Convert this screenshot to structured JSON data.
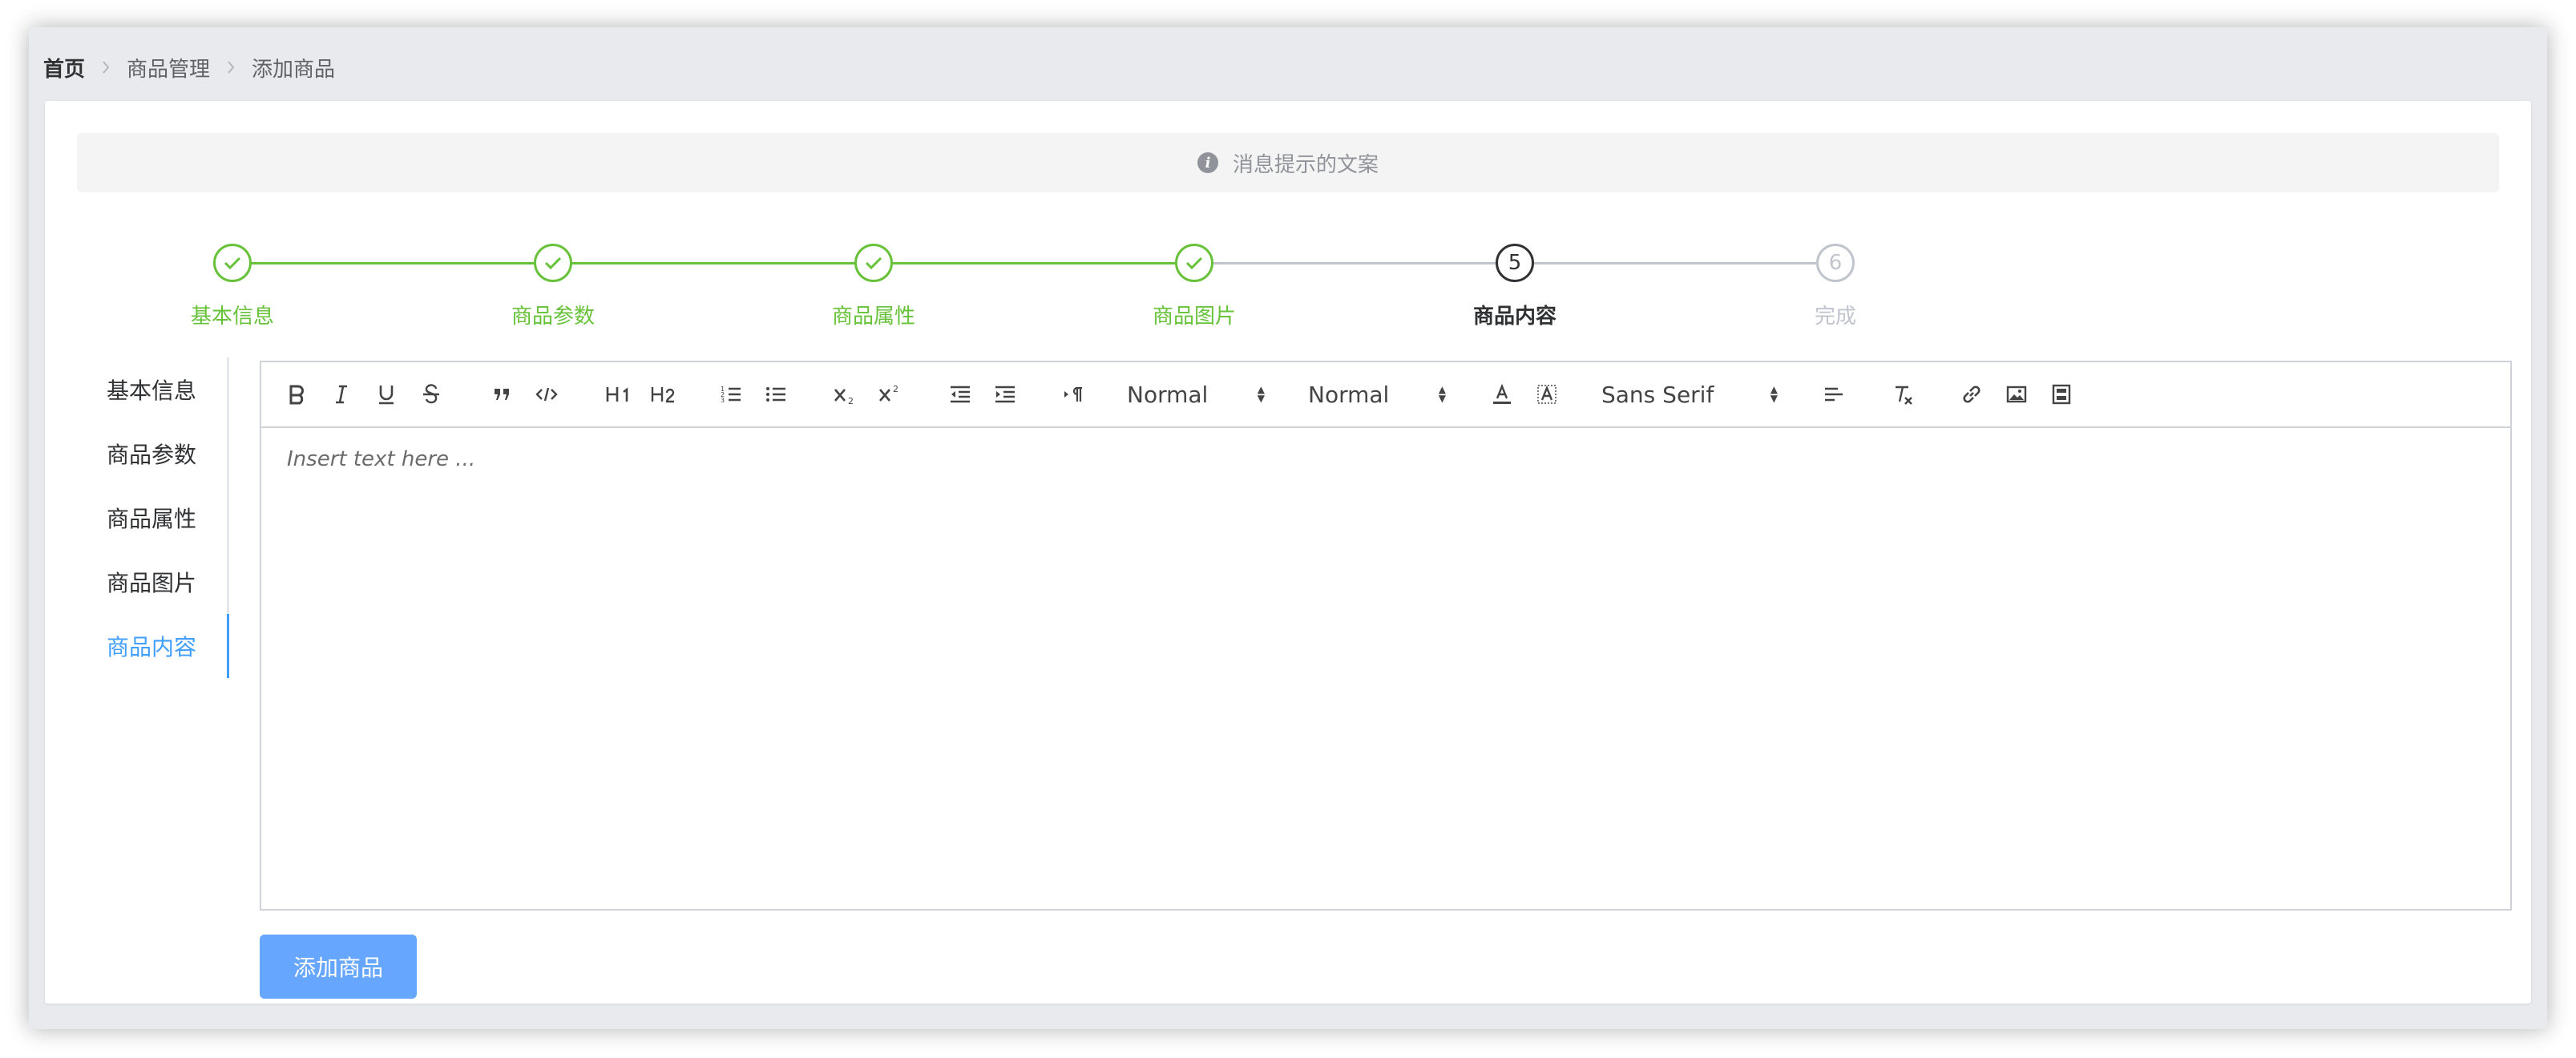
{
  "breadcrumb": {
    "home": "首页",
    "level1": "商品管理",
    "level2": "添加商品"
  },
  "alert": {
    "text": "消息提示的文案",
    "icon": "info-icon"
  },
  "steps": [
    {
      "index": "1",
      "title": "基本信息",
      "status": "done"
    },
    {
      "index": "2",
      "title": "商品参数",
      "status": "done"
    },
    {
      "index": "3",
      "title": "商品属性",
      "status": "done"
    },
    {
      "index": "4",
      "title": "商品图片",
      "status": "done"
    },
    {
      "index": "5",
      "title": "商品内容",
      "status": "active"
    },
    {
      "index": "6",
      "title": "完成",
      "status": "wait"
    }
  ],
  "tabs": [
    {
      "label": "基本信息",
      "active": false
    },
    {
      "label": "商品参数",
      "active": false
    },
    {
      "label": "商品属性",
      "active": false
    },
    {
      "label": "商品图片",
      "active": false
    },
    {
      "label": "商品内容",
      "active": true
    }
  ],
  "editor": {
    "placeholder": "Insert text here ...",
    "header_picker": "Normal",
    "size_picker": "Normal",
    "font_picker": "Sans Serif",
    "toolbar_icons": [
      "bold-icon",
      "italic-icon",
      "underline-icon",
      "strike-icon",
      "blockquote-icon",
      "code-block-icon",
      "header-1-icon",
      "header-2-icon",
      "ordered-list-icon",
      "bullet-list-icon",
      "subscript-icon",
      "superscript-icon",
      "outdent-icon",
      "indent-icon",
      "rtl-direction-icon",
      "color-icon",
      "background-icon",
      "align-icon",
      "clean-format-icon",
      "link-icon",
      "image-icon",
      "video-icon"
    ]
  },
  "submit_button": {
    "label": "添加商品"
  },
  "colors": {
    "success": "#67c23a",
    "primary": "#409eff",
    "button": "#66a6ff",
    "wait": "#c0c4cc",
    "text": "#303133"
  }
}
